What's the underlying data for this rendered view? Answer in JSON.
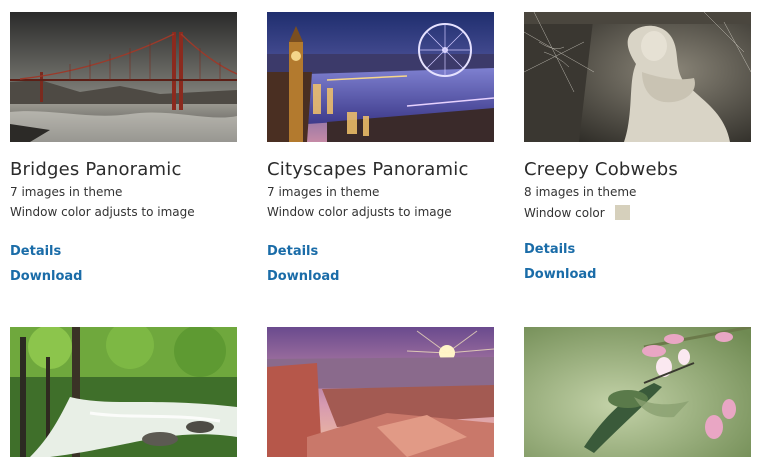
{
  "themes": [
    {
      "title": "Bridges Panoramic",
      "count": "7 images in theme",
      "window_color": "Window color adjusts to image",
      "details": "Details",
      "download": "Download",
      "thumbnail_icon": "golden-gate-bridge"
    },
    {
      "title": "Cityscapes Panoramic",
      "count": "7 images in theme",
      "window_color": "Window color adjusts to image",
      "details": "Details",
      "download": "Download",
      "thumbnail_icon": "london-night-skyline"
    },
    {
      "title": "Creepy Cobwebs",
      "count": "8 images in theme",
      "window_color": "Window color",
      "swatch_color": "#d6d0bc",
      "details": "Details",
      "download": "Download",
      "thumbnail_icon": "statue-with-cobwebs"
    }
  ],
  "row2_thumbnails": [
    "forest-stream",
    "canyon-sunset",
    "hummingbird-flowers"
  ],
  "colors": {
    "link": "#1a6ca8",
    "title": "#2b2b2b",
    "text": "#333333"
  }
}
